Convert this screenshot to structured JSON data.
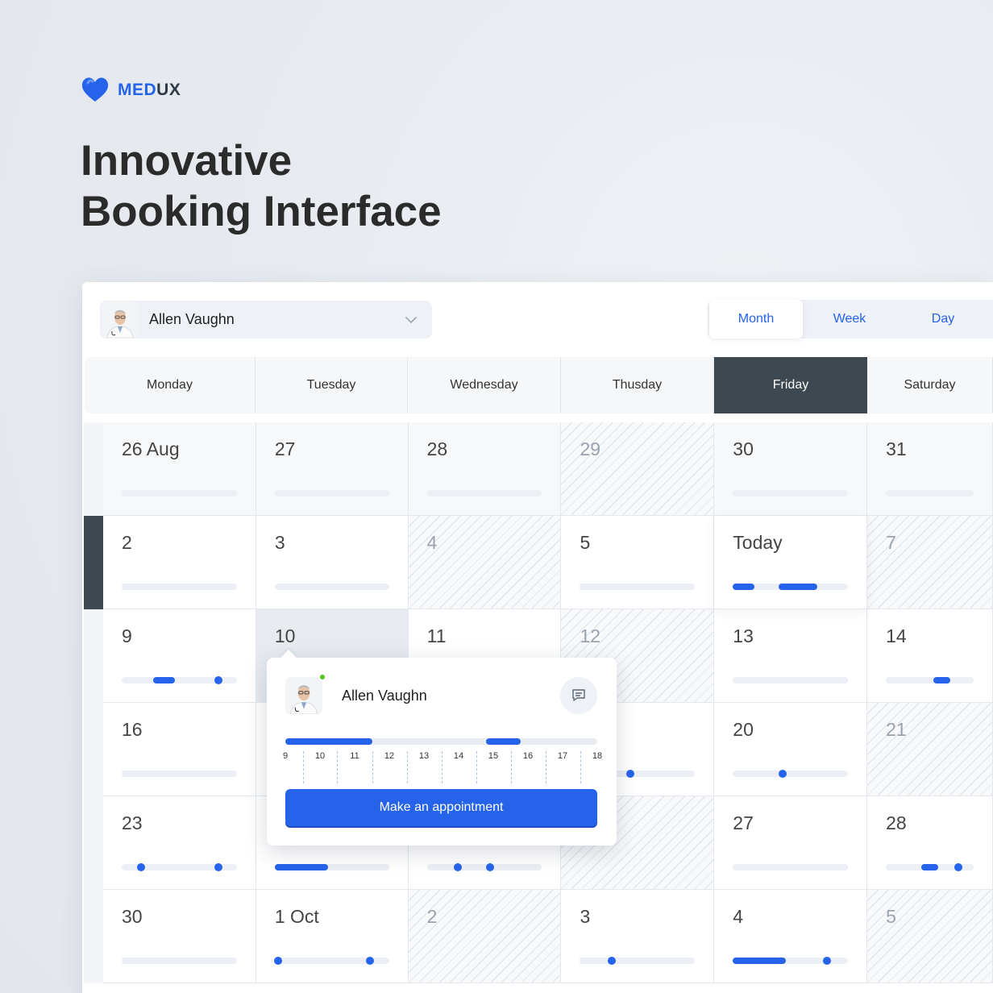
{
  "brand": {
    "name_part1": "MED",
    "name_part2": "UX",
    "logo_icon": "heart-icon"
  },
  "headline": {
    "line1": "Innovative",
    "line2": "Booking Interface"
  },
  "doctor_select": {
    "name": "Allen Vaughn",
    "avatar": "doctor-avatar",
    "icon": "chevron-down-icon"
  },
  "view_tabs": [
    {
      "label": "Month",
      "active": true
    },
    {
      "label": "Week",
      "active": false
    },
    {
      "label": "Day",
      "active": false
    }
  ],
  "weekdays": [
    "Monday",
    "Tuesday",
    "Wednesday",
    "Thusday",
    "Friday",
    "Saturday"
  ],
  "today_weekday_index": 4,
  "colors": {
    "accent": "#2563eb",
    "dark": "#3d4850",
    "online": "#52c41a"
  },
  "weeks": [
    {
      "active": false,
      "days": [
        {
          "label": "26 Aug",
          "state": "shade",
          "marks": []
        },
        {
          "label": "27",
          "state": "shade",
          "marks": []
        },
        {
          "label": "28",
          "state": "shade",
          "marks": []
        },
        {
          "label": "29",
          "state": "hatch",
          "marks": []
        },
        {
          "label": "30",
          "state": "shade",
          "marks": []
        },
        {
          "label": "31",
          "state": "shade",
          "marks": []
        }
      ]
    },
    {
      "active": true,
      "days": [
        {
          "label": "2",
          "state": "normal",
          "marks": []
        },
        {
          "label": "3",
          "state": "normal",
          "marks": []
        },
        {
          "label": "4",
          "state": "hatch",
          "marks": []
        },
        {
          "label": "5",
          "state": "normal",
          "marks": []
        },
        {
          "label": "Today",
          "state": "today",
          "marks": [
            {
              "type": "seg",
              "from": 0.0,
              "to": 0.19
            },
            {
              "type": "seg",
              "from": 0.4,
              "to": 0.73
            }
          ]
        },
        {
          "label": "7",
          "state": "hatch",
          "marks": []
        }
      ]
    },
    {
      "active": false,
      "days": [
        {
          "label": "9",
          "state": "normal",
          "marks": [
            {
              "type": "seg",
              "from": 0.27,
              "to": 0.46
            },
            {
              "type": "dot",
              "at": 0.84
            }
          ]
        },
        {
          "label": "10",
          "state": "sel",
          "marks": []
        },
        {
          "label": "11",
          "state": "normal",
          "marks": []
        },
        {
          "label": "12",
          "state": "hatch",
          "marks": []
        },
        {
          "label": "13",
          "state": "normal",
          "marks": []
        },
        {
          "label": "14",
          "state": "normal",
          "marks": [
            {
              "type": "seg",
              "from": 0.54,
              "to": 0.73
            }
          ]
        }
      ]
    },
    {
      "active": false,
      "days": [
        {
          "label": "16",
          "state": "normal",
          "marks": []
        },
        {
          "label": "",
          "state": "normal",
          "marks": []
        },
        {
          "label": "",
          "state": "normal",
          "marks": []
        },
        {
          "label": "",
          "state": "normal",
          "marks": [
            {
              "type": "dot",
              "at": 0.44
            }
          ]
        },
        {
          "label": "20",
          "state": "normal",
          "marks": [
            {
              "type": "dot",
              "at": 0.43
            }
          ]
        },
        {
          "label": "21",
          "state": "hatch",
          "marks": []
        }
      ]
    },
    {
      "active": false,
      "days": [
        {
          "label": "23",
          "state": "normal",
          "marks": [
            {
              "type": "dot",
              "at": 0.17
            },
            {
              "type": "dot",
              "at": 0.84
            }
          ]
        },
        {
          "label": "",
          "state": "normal",
          "marks": [
            {
              "type": "seg",
              "from": 0.0,
              "to": 0.47
            }
          ]
        },
        {
          "label": "",
          "state": "normal",
          "marks": [
            {
              "type": "dot",
              "at": 0.27
            },
            {
              "type": "dot",
              "at": 0.55
            }
          ]
        },
        {
          "label": "",
          "state": "hatch",
          "marks": []
        },
        {
          "label": "27",
          "state": "normal",
          "marks": []
        },
        {
          "label": "28",
          "state": "normal",
          "marks": [
            {
              "type": "seg",
              "from": 0.4,
              "to": 0.6
            },
            {
              "type": "dot",
              "at": 0.83
            }
          ]
        }
      ]
    },
    {
      "active": false,
      "days": [
        {
          "label": "30",
          "state": "normal",
          "marks": []
        },
        {
          "label": "1 Oct",
          "state": "normal",
          "marks": [
            {
              "type": "dot",
              "at": 0.03
            },
            {
              "type": "dot",
              "at": 0.83
            }
          ]
        },
        {
          "label": "2",
          "state": "hatch",
          "marks": []
        },
        {
          "label": "3",
          "state": "normal",
          "marks": [
            {
              "type": "dot",
              "at": 0.28
            }
          ]
        },
        {
          "label": "4",
          "state": "normal",
          "marks": [
            {
              "type": "seg",
              "from": 0.0,
              "to": 0.46
            },
            {
              "type": "dot",
              "at": 0.82
            }
          ]
        },
        {
          "label": "5",
          "state": "hatch",
          "marks": []
        }
      ]
    }
  ],
  "popup": {
    "name": "Allen Vaughn",
    "status": "online",
    "chat_icon": "chat-icon",
    "hours": [
      "9",
      "10",
      "11",
      "12",
      "13",
      "14",
      "15",
      "16",
      "17",
      "18"
    ],
    "booked": [
      {
        "from": 9,
        "to": 11.5
      },
      {
        "from": 14.8,
        "to": 15.8
      }
    ],
    "button_label": "Make an appointment"
  }
}
